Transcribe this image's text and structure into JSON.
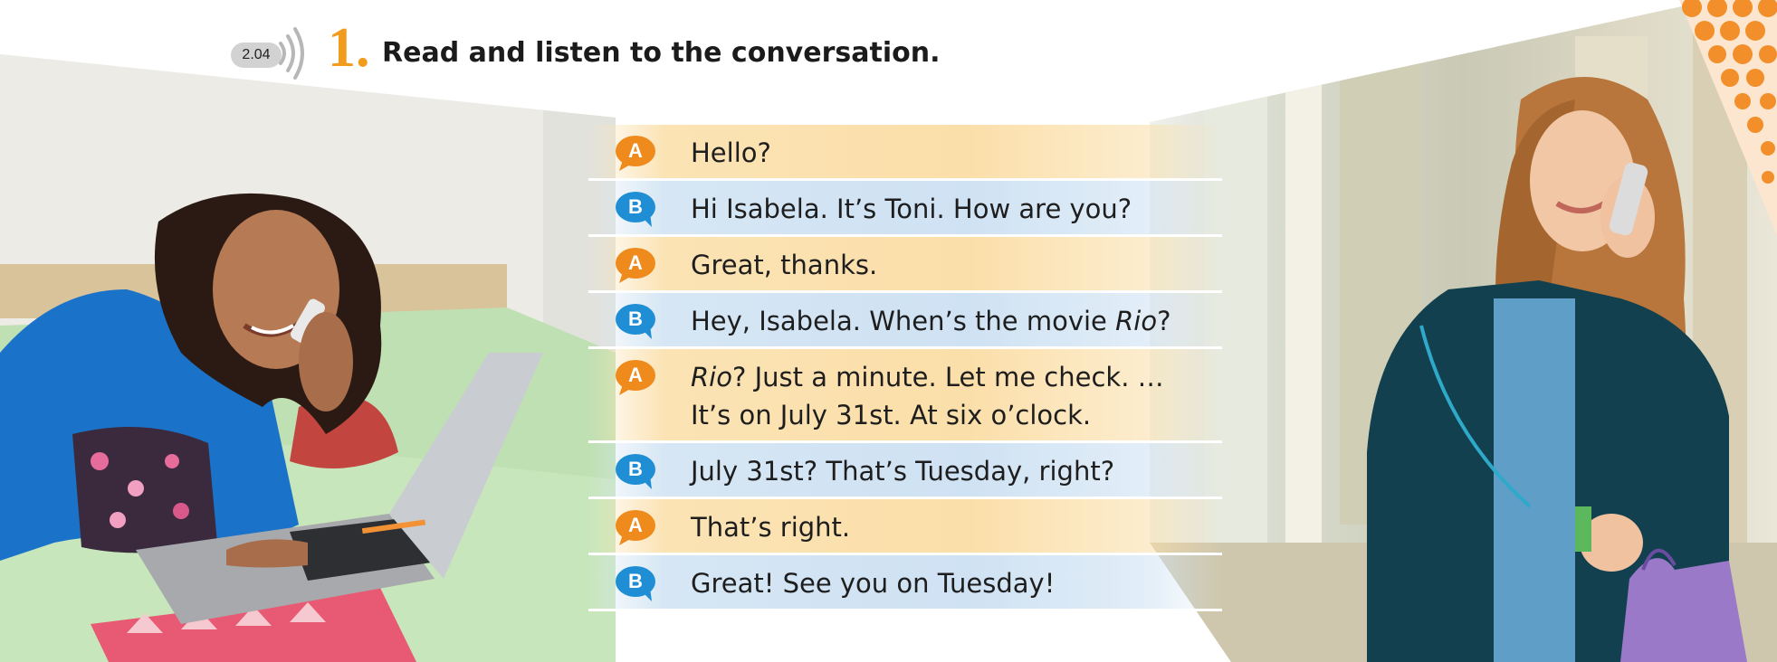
{
  "header": {
    "audio_track": "2.04",
    "exercise_number": "1.",
    "instruction": "Read and listen to the conversation."
  },
  "colors": {
    "speaker_a": "#ef8a1c",
    "speaker_b": "#1f8ed4",
    "number": "#f29c1e"
  },
  "icons": {
    "audio": "sound-waves-icon",
    "speaker_a": "speech-bubble-orange",
    "speaker_b": "speech-bubble-blue"
  },
  "dialogue": [
    {
      "speaker": "A",
      "parts": [
        {
          "text": "Hello?"
        }
      ]
    },
    {
      "speaker": "B",
      "parts": [
        {
          "text": "Hi Isabela. It’s Toni. How are you?"
        }
      ]
    },
    {
      "speaker": "A",
      "parts": [
        {
          "text": "Great, thanks."
        }
      ]
    },
    {
      "speaker": "B",
      "parts": [
        {
          "text": "Hey, Isabela. When’s the movie "
        },
        {
          "text": "Rio",
          "italic": true
        },
        {
          "text": "?"
        }
      ]
    },
    {
      "speaker": "A",
      "parts": [
        {
          "text": "Rio",
          "italic": true
        },
        {
          "text": "? Just a minute. Let me check. …"
        }
      ],
      "line2": "It’s on July 31st. At six o’clock."
    },
    {
      "speaker": "B",
      "parts": [
        {
          "text": "July 31st? That’s Tuesday, right?"
        }
      ]
    },
    {
      "speaker": "A",
      "parts": [
        {
          "text": "That’s right."
        }
      ]
    },
    {
      "speaker": "B",
      "parts": [
        {
          "text": "Great! See you on Tuesday!"
        }
      ]
    }
  ]
}
